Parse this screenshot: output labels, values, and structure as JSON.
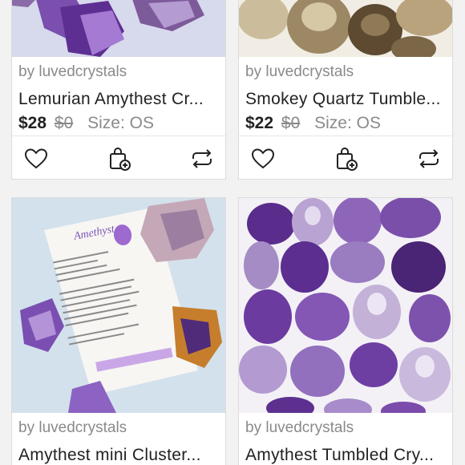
{
  "listings": [
    {
      "seller": "by luvedcrystals",
      "title": "Lemurian Amythest Cr...",
      "price": "$28",
      "original_price": "$0",
      "size": "Size: OS",
      "photo_colors": [
        "#cfd2e8",
        "#7b4fb0",
        "#c9b3e6"
      ]
    },
    {
      "seller": "by luvedcrystals",
      "title": "Smokey Quartz Tumble...",
      "price": "$22",
      "original_price": "$0",
      "size": "Size: OS",
      "photo_colors": [
        "#efe9dc",
        "#6e5a3c",
        "#c8b48c"
      ]
    },
    {
      "seller": "by luvedcrystals",
      "title": "Amythest mini Cluster...",
      "card_heading": "Amethyst",
      "photo_colors": [
        "#cfe0ee",
        "#8a5cc2",
        "#e9c97e"
      ]
    },
    {
      "seller": "by luvedcrystals",
      "title": "Amythest Tumbled Cry...",
      "photo_colors": [
        "#f3f1f6",
        "#5b2e8c",
        "#b596d6"
      ]
    }
  ],
  "actions": {
    "like_icon": "heart-icon",
    "bundle_icon": "bag-plus-icon",
    "share_icon": "share-arrows-icon"
  },
  "colors": {
    "text_primary": "#222222",
    "text_secondary": "#8a8a8a",
    "border": "#dcdcdc",
    "page_background": "#f2f2f2"
  }
}
